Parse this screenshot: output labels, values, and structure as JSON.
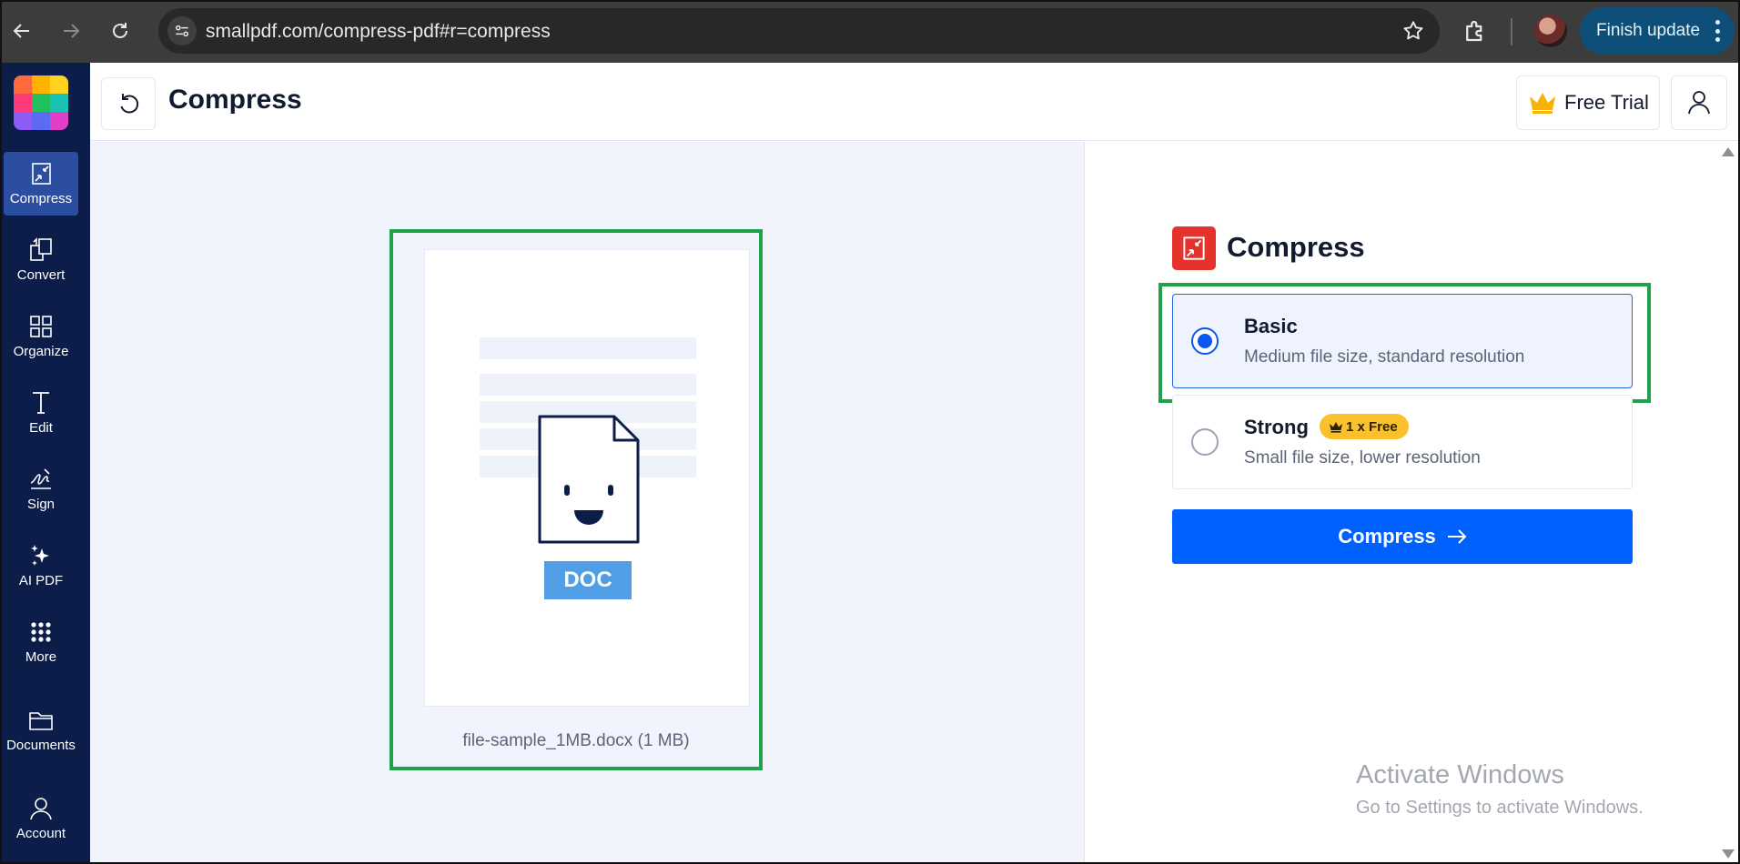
{
  "browser": {
    "url": "smallpdf.com/compress-pdf#r=compress",
    "finish_update_label": "Finish update"
  },
  "sidebar": {
    "logo_colors": [
      "#ff6a3d",
      "#ffb200",
      "#ffd21f",
      "#ff3a7a",
      "#20c05c",
      "#19c2b4",
      "#8b5cf6",
      "#5b6cf2",
      "#e040c8"
    ],
    "items": [
      {
        "label": "Compress",
        "icon": "compress-icon",
        "active": true
      },
      {
        "label": "Convert",
        "icon": "convert-icon"
      },
      {
        "label": "Organize",
        "icon": "organize-icon"
      },
      {
        "label": "Edit",
        "icon": "edit-icon"
      },
      {
        "label": "Sign",
        "icon": "sign-icon"
      },
      {
        "label": "AI PDF",
        "icon": "ai-sparkle-icon"
      },
      {
        "label": "More",
        "icon": "more-grid-icon"
      },
      {
        "label": "Documents",
        "icon": "folder-icon"
      },
      {
        "label": "Account",
        "icon": "account-icon"
      }
    ]
  },
  "header": {
    "title": "Compress",
    "free_trial_label": "Free Trial"
  },
  "preview": {
    "badge": "DOC",
    "file_caption": "file-sample_1MB.docx (1 MB)"
  },
  "panel": {
    "title": "Compress",
    "options": [
      {
        "title": "Basic",
        "description": "Medium file size, standard resolution",
        "selected": true
      },
      {
        "title": "Strong",
        "badge": "1 x Free",
        "description": "Small file size, lower resolution",
        "selected": false
      }
    ],
    "action_label": "Compress"
  },
  "watermark": {
    "line1": "Activate Windows",
    "line2": "Go to Settings to activate Windows."
  },
  "colors": {
    "accent_blue": "#0061fe",
    "sidebar_bg": "#0d1d4a",
    "highlight_green": "#1fa24a",
    "brand_red": "#e5322d",
    "badge_yellow": "#fbc02d"
  }
}
